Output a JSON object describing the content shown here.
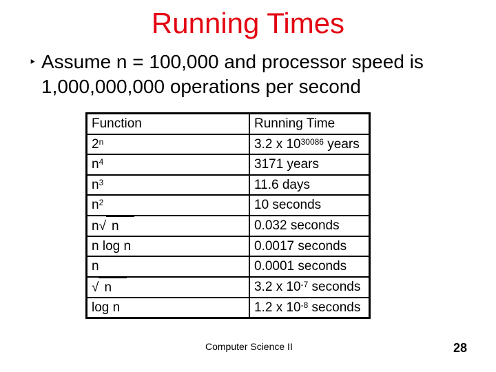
{
  "slide": {
    "title": "Running Times",
    "bullet_icon": "triangle-bullet-icon",
    "bullet_glyph": "‣",
    "bullet_line1": "Assume n = 100,000 and processor speed is",
    "bullet_line2": "1,000,000,000 operations per second",
    "title_color": "#e30613"
  },
  "table": {
    "headers": [
      "Function",
      "Running Time"
    ],
    "rows": [
      {
        "f_base": "2",
        "f_sup": "n",
        "t_pre": "3.2 x 10",
        "t_sup": "30086",
        "t_post": " years"
      },
      {
        "f_base": "n",
        "f_sup": "4",
        "t_pre": "3171 years",
        "t_sup": "",
        "t_post": ""
      },
      {
        "f_base": "n",
        "f_sup": "3",
        "t_pre": "11.6 days",
        "t_sup": "",
        "t_post": ""
      },
      {
        "f_base": "n",
        "f_sup": "2",
        "t_pre": "10 seconds",
        "t_sup": "",
        "t_post": ""
      },
      {
        "f_base": "n",
        "f_sqrt": "n",
        "t_pre": "0.032 seconds",
        "t_sup": "",
        "t_post": ""
      },
      {
        "f_base": "n log n",
        "t_pre": "0.0017 seconds",
        "t_sup": "",
        "t_post": ""
      },
      {
        "f_base": "n",
        "t_pre": "0.0001 seconds",
        "t_sup": "",
        "t_post": ""
      },
      {
        "f_base": "",
        "f_sqrt": "n",
        "t_pre": "3.2 x 10",
        "t_sup": "-7",
        "t_post": " seconds"
      },
      {
        "f_base": "log n",
        "t_pre": "1.2 x 10",
        "t_sup": "-8",
        "t_post": " seconds"
      }
    ]
  },
  "footer": {
    "text": "Computer Science II",
    "page_number": "28"
  },
  "sqrt_symbol": "√"
}
